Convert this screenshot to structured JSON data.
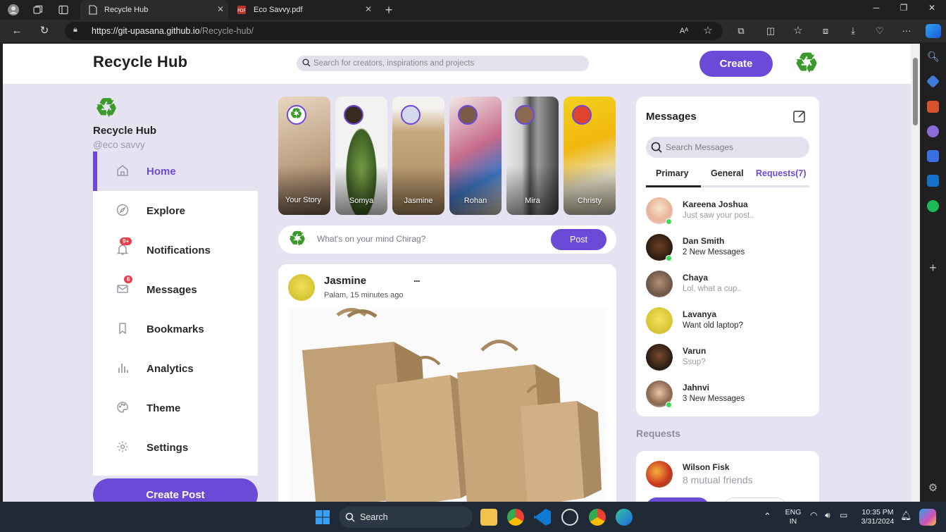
{
  "browser": {
    "tabs": [
      {
        "title": "Recycle Hub",
        "active": true
      },
      {
        "title": "Eco Savvy.pdf",
        "active": false
      }
    ],
    "url_host": "https://git-upasana.github.io",
    "url_path": "/Recycle-hub/"
  },
  "header": {
    "title": "Recycle Hub",
    "search_placeholder": "Search for creators, inspirations and projects",
    "create_label": "Create"
  },
  "profile": {
    "name": "Recycle Hub",
    "handle": "@eco savvy"
  },
  "menu": [
    {
      "label": "Home",
      "icon": "home-icon",
      "active": true
    },
    {
      "label": "Explore",
      "icon": "compass-icon"
    },
    {
      "label": "Notifications",
      "icon": "bell-icon",
      "badge": "9+"
    },
    {
      "label": "Messages",
      "icon": "envelope-icon",
      "badge": "6"
    },
    {
      "label": "Bookmarks",
      "icon": "bookmark-icon"
    },
    {
      "label": "Analytics",
      "icon": "bar-chart-icon"
    },
    {
      "label": "Theme",
      "icon": "palette-icon"
    },
    {
      "label": "Settings",
      "icon": "gear-icon"
    }
  ],
  "create_post_label": "Create Post",
  "stories": [
    {
      "name": "Your Story"
    },
    {
      "name": "Somya"
    },
    {
      "name": "Jasmine"
    },
    {
      "name": "Rohan"
    },
    {
      "name": "Mira"
    },
    {
      "name": "Christy"
    }
  ],
  "composer": {
    "placeholder": "What's on your mind Chirag?",
    "post_label": "Post"
  },
  "feed": {
    "author": "Jasmine",
    "meta": "Palam, 15 minutes ago",
    "more": "..."
  },
  "messages": {
    "title": "Messages",
    "search_placeholder": "Search Messages",
    "tabs": [
      "Primary",
      "General",
      "Requests(7)"
    ],
    "contacts": [
      {
        "name": "Kareena Joshua",
        "message": "Just saw your post..",
        "online": true
      },
      {
        "name": "Dan Smith",
        "message": "2 New Messages",
        "online": true,
        "unread": true
      },
      {
        "name": "Chaya",
        "message": "Lol, what a cup..",
        "online": false
      },
      {
        "name": "Lavanya",
        "message": "Want old laptop?",
        "online": false,
        "unread": true
      },
      {
        "name": "Varun",
        "message": "Ssup?",
        "online": false
      },
      {
        "name": "Jahnvi",
        "message": "3 New Messages",
        "online": true,
        "unread": true
      }
    ]
  },
  "requests": {
    "title": "Requests",
    "items": [
      {
        "name": "Wilson Fisk",
        "mutual": "8 mutual friends"
      }
    ]
  },
  "taskbar": {
    "search_label": "Search",
    "lang_top": "ENG",
    "lang_bottom": "IN",
    "time": "10:35 PM",
    "date": "3/31/2024"
  },
  "colors": {
    "accent": "#6c4ad8",
    "page_bg": "#e5e3f1",
    "recycle_green": "#3b9b2a"
  }
}
